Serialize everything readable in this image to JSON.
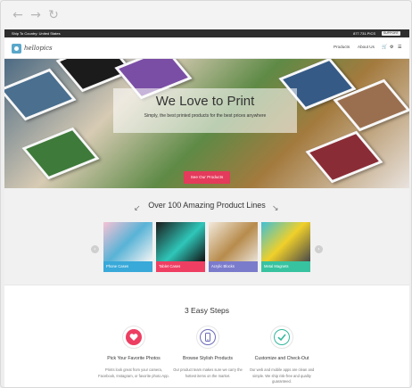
{
  "site": {
    "ship_to": "Ship To Country: United States",
    "phone": "877.731.PICS",
    "support": "SUPPORT",
    "logo": "hellopics",
    "menu": [
      "Products",
      "About Us"
    ]
  },
  "hero": {
    "title": "We Love to Print",
    "subtitle": "Simply, the best printed products for the best prices anywhere",
    "cta": "See Our Products"
  },
  "products": {
    "title": "Over 100 Amazing Product Lines",
    "items": [
      {
        "label": "Phone Cases",
        "color": "#38a9d9"
      },
      {
        "label": "Tablet Cases",
        "color": "#ee3f63"
      },
      {
        "label": "Acrylic Blocks",
        "color": "#7b7bcc"
      },
      {
        "label": "Metal Magnets",
        "color": "#38c3a0"
      }
    ]
  },
  "steps": {
    "title": "3 Easy Steps",
    "items": [
      {
        "title": "Pick Your Favorite Photos",
        "text": "Prints look great from your camera, Facebook, Instagram, or favorite photo App.",
        "icon": "heart-icon",
        "color": "#ec3f62"
      },
      {
        "title": "Browse Stylish Products",
        "text": "Our product team makes sure we carry the hottest items on the market.",
        "icon": "phone-icon",
        "color": "#6b6bb8"
      },
      {
        "title": "Customize and Check-Out",
        "text": "Our web and mobile apps are clean and simple. We ship risk-free and quality guaranteed.",
        "icon": "check-icon",
        "color": "#32b89c"
      }
    ]
  },
  "colors": {
    "brand_pink": "#e43a5b",
    "topbar": "#2d2d2d"
  }
}
